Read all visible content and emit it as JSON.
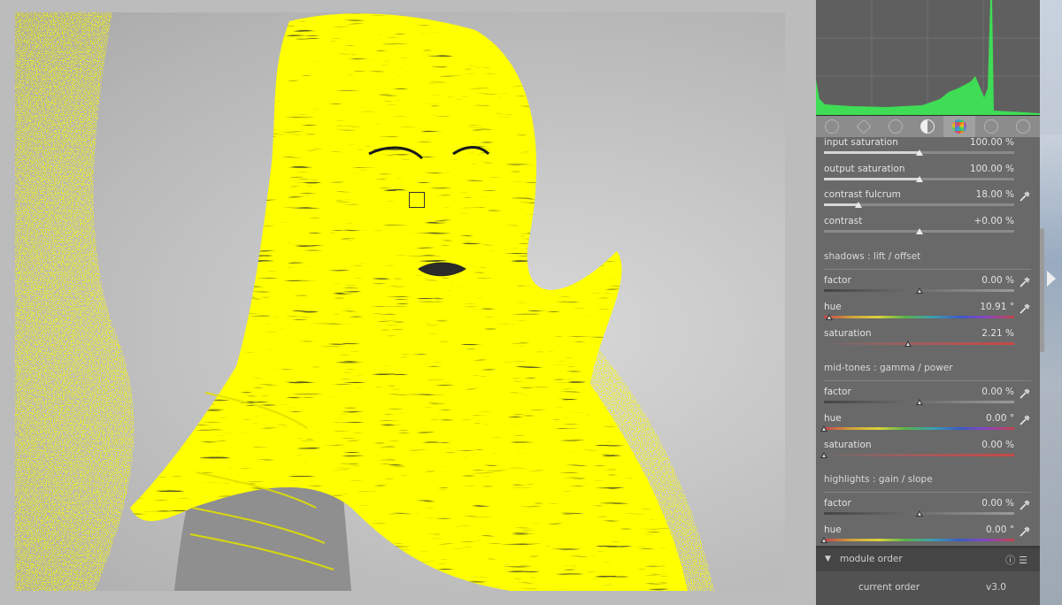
{
  "colors": {
    "highlight": "#ffff00",
    "panel": "#696969",
    "histogram_fill": "#3fdc55"
  },
  "tabs": [
    {
      "icon": "power-icon"
    },
    {
      "icon": "star-icon"
    },
    {
      "icon": "circle-icon"
    },
    {
      "icon": "tone-icon"
    },
    {
      "icon": "color-wheel-icon",
      "active": true
    },
    {
      "icon": "correct-icon"
    },
    {
      "icon": "effects-icon"
    }
  ],
  "module": {
    "input_saturation": {
      "label": "input saturation",
      "value": "100.00 %",
      "level": 0.5
    },
    "output_saturation": {
      "label": "output saturation",
      "value": "100.00 %",
      "level": 0.5
    },
    "contrast_fulcrum": {
      "label": "contrast fulcrum",
      "value": "18.00 %",
      "level": 0.18
    },
    "contrast": {
      "label": "contrast",
      "value": "+0.00 %",
      "level": 0.5
    },
    "shadows": {
      "title": "shadows : lift / offset",
      "factor": {
        "label": "factor",
        "value": "0.00 %",
        "level": 0.5
      },
      "hue": {
        "label": "hue",
        "value": "10.91 °",
        "level": 0.03
      },
      "saturation": {
        "label": "saturation",
        "value": "2.21 %",
        "level": 0.44
      }
    },
    "midtones": {
      "title": "mid-tones : gamma / power",
      "factor": {
        "label": "factor",
        "value": "0.00 %",
        "level": 0.5
      },
      "hue": {
        "label": "hue",
        "value": "0.00 °",
        "level": 0.0
      },
      "saturation": {
        "label": "saturation",
        "value": "0.00 %",
        "level": 0.0
      }
    },
    "highlights": {
      "title": "highlights : gain / slope",
      "factor": {
        "label": "factor",
        "value": "0.00 %",
        "level": 0.5
      },
      "hue": {
        "label": "hue",
        "value": "0.00 °",
        "level": 0.0
      }
    }
  },
  "module_order": {
    "title": "module order",
    "current_label": "current order",
    "current_value": "v3.0"
  }
}
